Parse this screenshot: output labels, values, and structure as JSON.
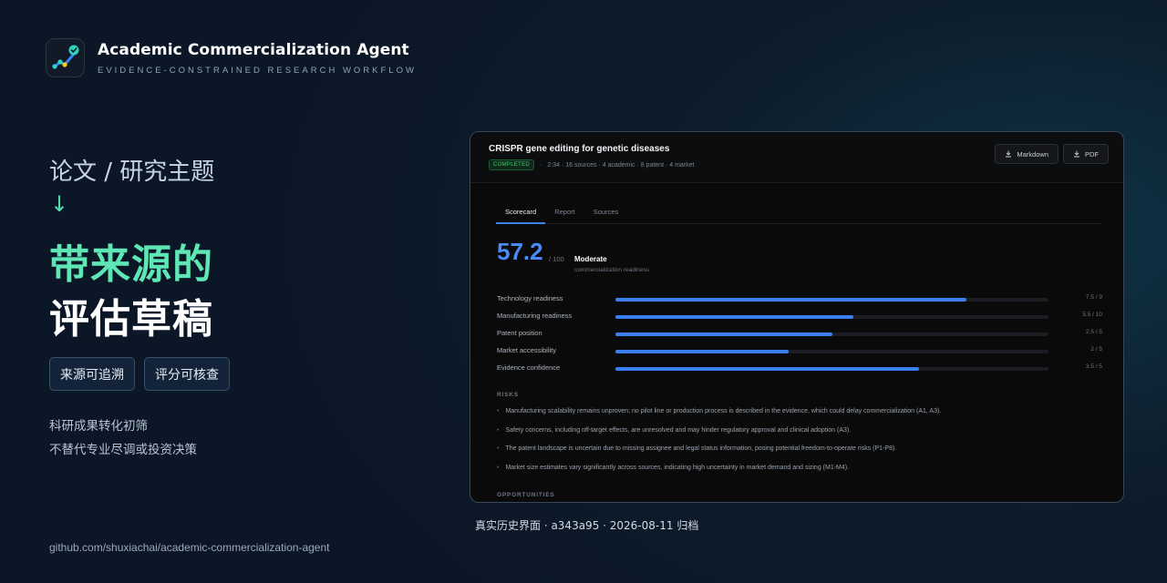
{
  "brand": {
    "title": "Academic Commercialization Agent",
    "subtitle": "EVIDENCE-CONSTRAINED RESEARCH WORKFLOW",
    "logo_icon": "trend-chart-check-icon"
  },
  "hero": {
    "from": "论文 / 研究主题",
    "arrow": "↓",
    "headline_1": "带来源的",
    "headline_2": "评估草稿"
  },
  "tags": [
    "来源可追溯",
    "评分可核查"
  ],
  "notes": [
    "科研成果转化初筛",
    "不替代专业尽调或投资决策"
  ],
  "repo": "github.com/shuxiachai/academic-commercialization-agent",
  "screenshot": {
    "topic": "CRISPR gene editing for genetic diseases",
    "status": "COMPLETED",
    "meta": "2:34 · 16 sources · 4 academic · 8 patent · 4 market",
    "buttons": [
      "Markdown",
      "PDF"
    ],
    "tabs": [
      "Scorecard",
      "Report",
      "Sources"
    ],
    "score": "57.2",
    "score_max": "/ 100",
    "level": "Moderate",
    "level_sub": "commercialization readiness",
    "metrics": [
      {
        "label": "Technology readiness",
        "value": "7.5 / 9",
        "fraction": 0.81
      },
      {
        "label": "Manufacturing readiness",
        "value": "5.5 / 10",
        "fraction": 0.55
      },
      {
        "label": "Patent position",
        "value": "2.5 / 5",
        "fraction": 0.5
      },
      {
        "label": "Market accessibility",
        "value": "2 / 5",
        "fraction": 0.4
      },
      {
        "label": "Evidence confidence",
        "value": "3.5 / 5",
        "fraction": 0.7
      }
    ],
    "risks_heading": "RISKS",
    "risks": [
      "Manufacturing scalability remains unproven; no pilot line or production process is described in the evidence, which could delay commercialization (A1, A3).",
      "Safety concerns, including off-target effects, are unresolved and may hinder regulatory approval and clinical adoption (A3).",
      "The patent landscape is uncertain due to missing assignee and legal status information, posing potential freedom-to-operate risks (P1-P8).",
      "Market size estimates vary significantly across sources, indicating high uncertainty in market demand and sizing (M1-M4)."
    ],
    "opportunities_heading": "OPPORTUNITIES",
    "accent": "#3b82f6",
    "status_color": "#3fd06e"
  },
  "caption": "真实历史界面 · a343a95 · 2026-08-11 归档"
}
